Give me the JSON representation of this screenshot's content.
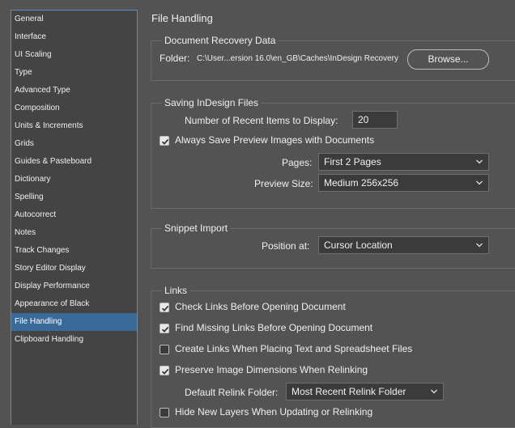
{
  "sidebar": {
    "items": [
      {
        "label": "General"
      },
      {
        "label": "Interface"
      },
      {
        "label": "UI Scaling"
      },
      {
        "label": "Type"
      },
      {
        "label": "Advanced Type"
      },
      {
        "label": "Composition"
      },
      {
        "label": "Units & Increments"
      },
      {
        "label": "Grids"
      },
      {
        "label": "Guides & Pasteboard"
      },
      {
        "label": "Dictionary"
      },
      {
        "label": "Spelling"
      },
      {
        "label": "Autocorrect"
      },
      {
        "label": "Notes"
      },
      {
        "label": "Track Changes"
      },
      {
        "label": "Story Editor Display"
      },
      {
        "label": "Display Performance"
      },
      {
        "label": "Appearance of Black"
      },
      {
        "label": "File Handling"
      },
      {
        "label": "Clipboard Handling"
      }
    ],
    "selected": "File Handling"
  },
  "main": {
    "title": "File Handling",
    "recovery": {
      "legend": "Document Recovery Data",
      "folder_label": "Folder:",
      "folder_path": "C:\\User...ersion 16.0\\en_GB\\Caches\\InDesign Recovery",
      "browse_label": "Browse..."
    },
    "saving": {
      "legend": "Saving InDesign Files",
      "recent_label": "Number of Recent Items to Display:",
      "recent_value": "20",
      "preview_check_label": "Always Save Preview Images with Documents",
      "preview_checked": true,
      "pages_label": "Pages:",
      "pages_value": "First 2 Pages",
      "preview_size_label": "Preview Size:",
      "preview_size_value": "Medium 256x256"
    },
    "snippet": {
      "legend": "Snippet Import",
      "position_label": "Position at:",
      "position_value": "Cursor Location"
    },
    "links": {
      "legend": "Links",
      "check_links_label": "Check Links Before Opening Document",
      "check_links_checked": true,
      "find_missing_label": "Find Missing Links Before Opening Document",
      "find_missing_checked": true,
      "create_links_label": "Create Links When Placing Text and Spreadsheet Files",
      "create_links_checked": false,
      "preserve_dims_label": "Preserve Image Dimensions When Relinking",
      "preserve_dims_checked": true,
      "relink_folder_label": "Default Relink Folder:",
      "relink_folder_value": "Most Recent Relink Folder",
      "hide_layers_label": "Hide New Layers When Updating or Relinking",
      "hide_layers_checked": false
    }
  },
  "colors": {
    "background": "#535353",
    "sidebar_bg": "#444444",
    "selection": "#3a6a9a"
  }
}
